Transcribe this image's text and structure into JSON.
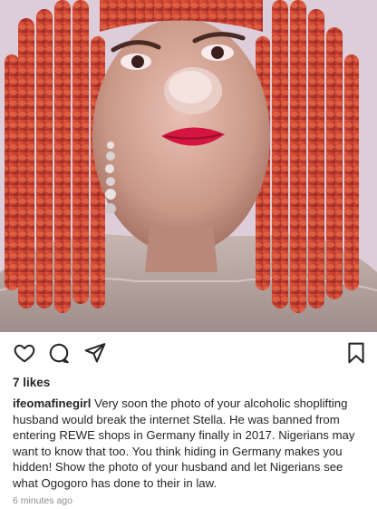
{
  "post": {
    "likes": "7 likes",
    "username": "ifeomafinegirl",
    "caption": "Very soon the photo of your alcoholic shoplifting husband would break the internet Stella. He was banned from entering REWE shops in Germany finally in 2017. Nigerians may want to know that too. You think hiding in Germany makes you hidden! Show the photo of your husband and let Nigerians see what Ogogoro has done to their in law.",
    "timestamp": "6 minutes ago"
  },
  "icons": {
    "like": "heart-icon",
    "comment": "comment-icon",
    "share": "paper-plane-icon",
    "save": "bookmark-icon"
  },
  "colors": {
    "text": "#262626",
    "muted": "#8e8e8e",
    "hair": "#c8452f",
    "lips": "#d3153f"
  }
}
